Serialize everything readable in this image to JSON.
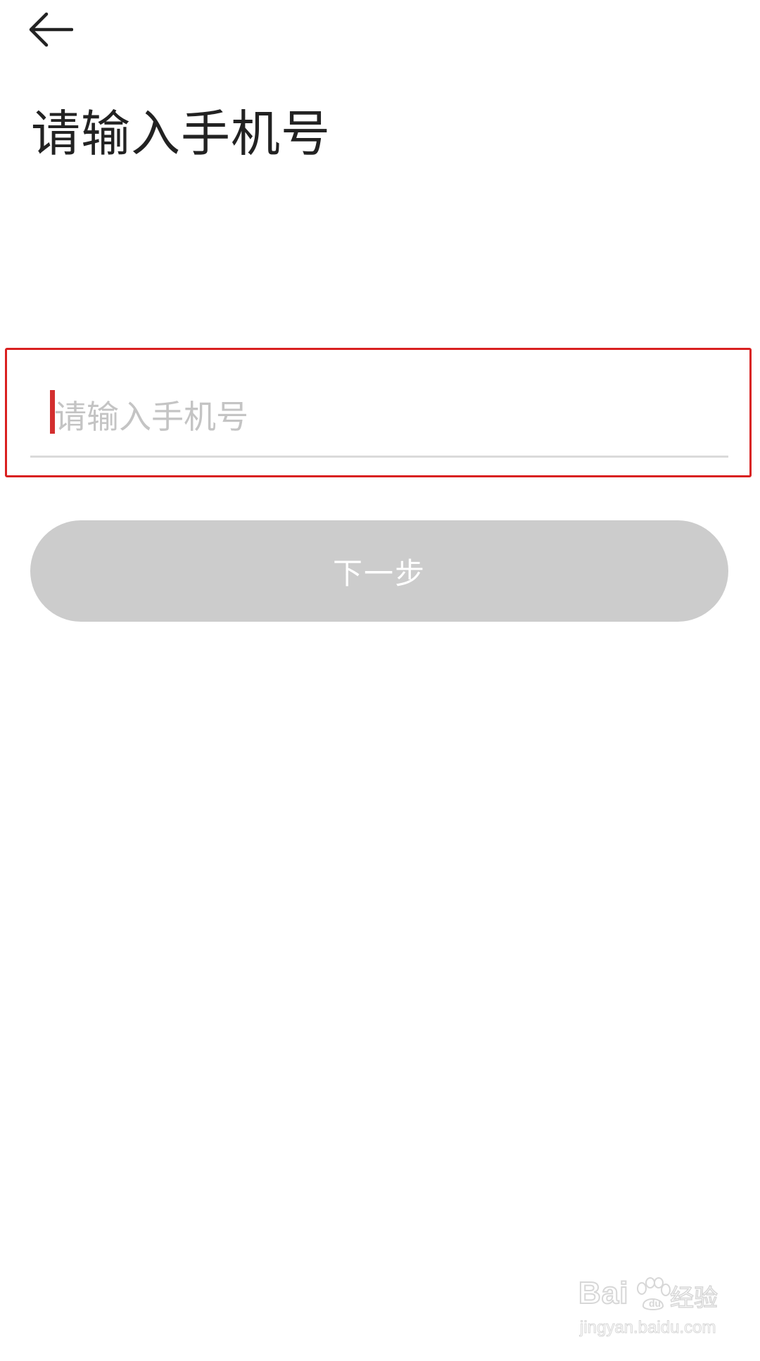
{
  "header": {
    "back_icon": "arrow-left-icon"
  },
  "page": {
    "title": "请输入手机号"
  },
  "phone_input": {
    "value": "",
    "placeholder": "请输入手机号"
  },
  "next_button": {
    "label": "下一步"
  },
  "colors": {
    "highlight_border": "#d92020",
    "caret": "#d32f2f",
    "button_disabled_bg": "#cccccc",
    "placeholder": "#c4c4c4"
  },
  "watermark": {
    "brand": "Bai  ",
    "suffix": "经验",
    "url": "jingyan.baidu.com",
    "icon": "paw-icon"
  }
}
